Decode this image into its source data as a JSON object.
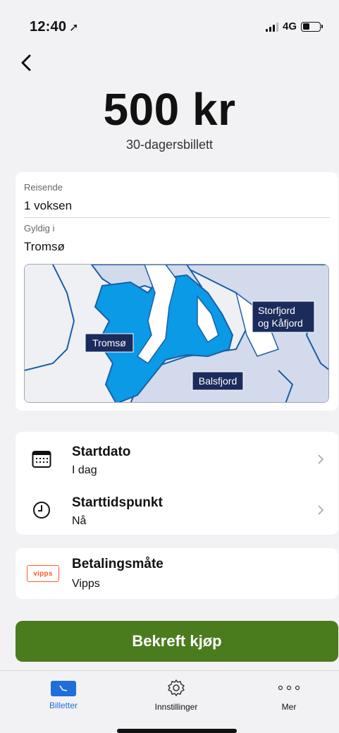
{
  "status": {
    "time": "12:40",
    "network": "4G"
  },
  "header": {
    "price": "500 kr",
    "ticket_name": "30-dagersbillett"
  },
  "details": {
    "traveller_label": "Reisende",
    "traveller_value": "1 voksen",
    "valid_label": "Gyldig i",
    "valid_value": "Tromsø",
    "map": {
      "zones": [
        "Tromsø",
        "Storfjord og Kåfjord",
        "Balsfjord"
      ],
      "selected_zone": "Tromsø",
      "colors": {
        "selected": "#0a9ae6",
        "other": "#d3daeb",
        "label_bg": "#1b2b5c",
        "border": "#1a5fa8"
      }
    }
  },
  "dates": {
    "start_date_title": "Startdato",
    "start_date_value": "I dag",
    "start_time_title": "Starttidspunkt",
    "start_time_value": "Nå"
  },
  "payment": {
    "title": "Betalingsmåte",
    "value": "Vipps",
    "logo_text": "vipps"
  },
  "confirm_label": "Bekreft kjøp",
  "tabs": {
    "tickets": "Billetter",
    "settings": "Innstillinger",
    "more": "Mer",
    "active_color": "#1e6fd9"
  },
  "icons": {
    "back": "chevron-left-icon",
    "calendar": "calendar-icon",
    "clock": "clock-icon",
    "chevron": "chevron-right-icon",
    "tickets": "tickets-icon",
    "settings": "gear-icon",
    "more": "more-dots-icon"
  }
}
